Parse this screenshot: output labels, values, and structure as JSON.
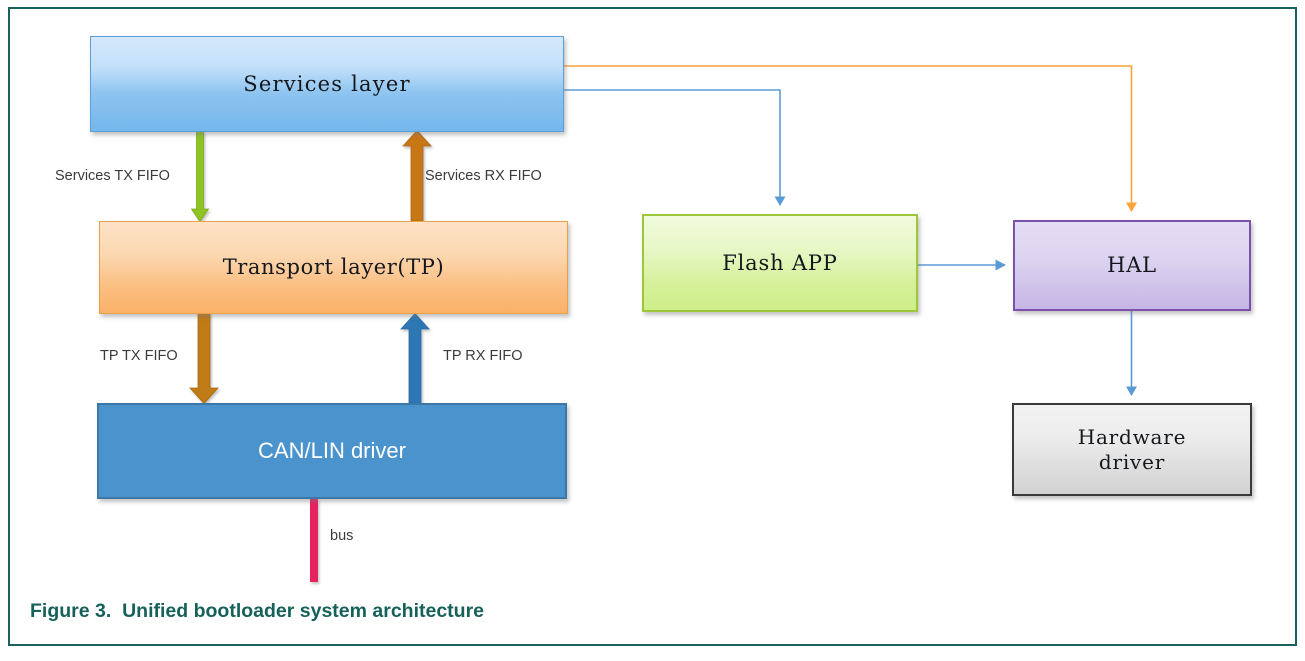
{
  "figure": {
    "caption": "Figure 3.  Unified bootloader system architecture",
    "border_color": "#18615c",
    "caption_color": "#17615b"
  },
  "nodes": {
    "services_layer": {
      "label": "Services layer",
      "fill": "#9ccdf2",
      "border": "#5d9ed6"
    },
    "transport_layer": {
      "label": "Transport layer(TP)",
      "fill": "#fbc287",
      "border": "#e9a24a"
    },
    "can_lin_driver": {
      "label": "CAN/LIN driver",
      "fill": "#4a93cd",
      "border": "#3b78a8"
    },
    "flash_app": {
      "label": "Flash APP",
      "fill": "#d9f29c",
      "border": "#9dc63b"
    },
    "hal": {
      "label": "HAL",
      "fill": "#cfc4e9",
      "border": "#7b52ab"
    },
    "hardware_driver": {
      "label": "Hardware\ndriver",
      "fill": "#e2e2e2",
      "border": "#3a3a3a"
    }
  },
  "edges": {
    "services_tx_fifo": {
      "label": "Services TX FIFO",
      "color": "#8fc320",
      "direction": "down",
      "from": "services_layer",
      "to": "transport_layer"
    },
    "services_rx_fifo": {
      "label": "Services RX FIFO",
      "color": "#c87714",
      "direction": "up",
      "from": "transport_layer",
      "to": "services_layer"
    },
    "tp_tx_fifo": {
      "label": "TP TX FIFO",
      "color": "#c07a12",
      "direction": "down",
      "from": "transport_layer",
      "to": "can_lin_driver"
    },
    "tp_rx_fifo": {
      "label": "TP RX FIFO",
      "color": "#2f77b5",
      "direction": "up",
      "from": "can_lin_driver",
      "to": "transport_layer"
    },
    "bus": {
      "label": "bus",
      "color": "#e6215e",
      "direction": "none",
      "from": "can_lin_driver",
      "to": ""
    },
    "services_to_flash": {
      "label": "",
      "color": "#5b9bd5",
      "direction": "down",
      "from": "services_layer",
      "to": "flash_app"
    },
    "services_to_hal": {
      "label": "",
      "color": "#f9a339",
      "direction": "down",
      "from": "services_layer",
      "to": "hal"
    },
    "flash_to_hal": {
      "label": "",
      "color": "#5b9bd5",
      "direction": "right",
      "from": "flash_app",
      "to": "hal"
    },
    "hal_to_hardware": {
      "label": "",
      "color": "#5b9bd5",
      "direction": "down",
      "from": "hal",
      "to": "hardware_driver"
    }
  }
}
